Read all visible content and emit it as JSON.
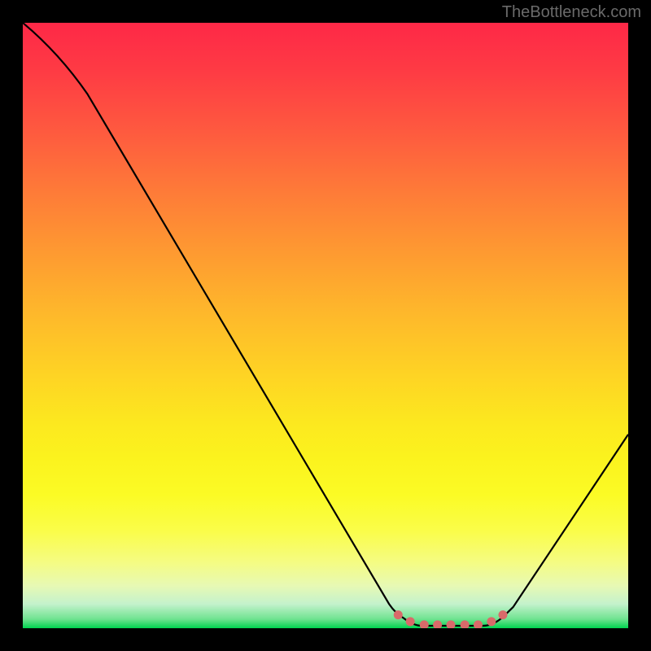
{
  "watermark": "TheBottleneck.com",
  "chart_data": {
    "type": "line",
    "title": "",
    "xlabel": "",
    "ylabel": "",
    "xlim": [
      0,
      100
    ],
    "ylim": [
      0,
      100
    ],
    "series": [
      {
        "name": "curve",
        "points": [
          {
            "x": 0,
            "y": 100
          },
          {
            "x": 10.7,
            "y": 88.2
          },
          {
            "x": 60.5,
            "y": 4.0
          },
          {
            "x": 63.0,
            "y": 1.6
          },
          {
            "x": 66.0,
            "y": 0.4
          },
          {
            "x": 76.0,
            "y": 0.4
          },
          {
            "x": 79.0,
            "y": 1.6
          },
          {
            "x": 81.0,
            "y": 3.5
          },
          {
            "x": 100,
            "y": 32.0
          }
        ],
        "highlight_points": [
          {
            "x": 62.0,
            "y": 2.2
          },
          {
            "x": 64.0,
            "y": 1.1
          },
          {
            "x": 66.3,
            "y": 0.55
          },
          {
            "x": 68.5,
            "y": 0.55
          },
          {
            "x": 70.7,
            "y": 0.55
          },
          {
            "x": 73.0,
            "y": 0.55
          },
          {
            "x": 75.2,
            "y": 0.55
          },
          {
            "x": 77.4,
            "y": 1.1
          },
          {
            "x": 79.3,
            "y": 2.2
          }
        ]
      }
    ],
    "colors": {
      "curve": "#000000",
      "highlight_marker": "#d96a6a",
      "gradient_top": "#fe2847",
      "gradient_bottom": "#00d34f"
    }
  }
}
